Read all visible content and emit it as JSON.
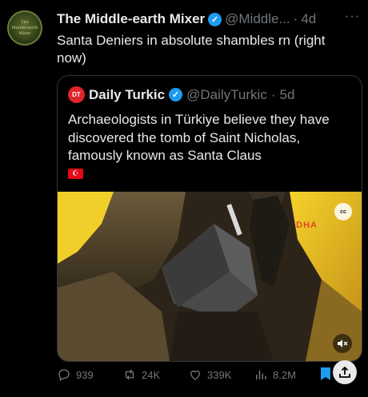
{
  "tweet": {
    "author_name": "The Middle-earth Mixer",
    "handle": "@Middle...",
    "separator": "·",
    "time": "4d",
    "more": "···",
    "text": "Santa Deniers in absolute shambles rn (right now)",
    "avatar_lines": [
      "The",
      "Middle-earth",
      "Mixer"
    ]
  },
  "quote": {
    "author_name": "Daily Turkic",
    "avatar_initials": "DT",
    "handle": "@DailyTurkic",
    "separator": "·",
    "time": "5d",
    "text": "Archaeologists in Türkiye believe they have discovered the tomb of Saint Nicholas, famously known as Santa Claus",
    "flag_symbol": "☪",
    "media": {
      "watermark": "DHA",
      "cc_label": "cc",
      "mute_icon": "🔇"
    }
  },
  "actions": {
    "replies": "939",
    "reposts": "24K",
    "likes": "339K",
    "views": "8.2M"
  },
  "colors": {
    "background": "#000000",
    "text": "#e7e9ea",
    "muted": "#71767b",
    "verified": "#1d9bf0",
    "bookmark": "#1d9bf0"
  }
}
